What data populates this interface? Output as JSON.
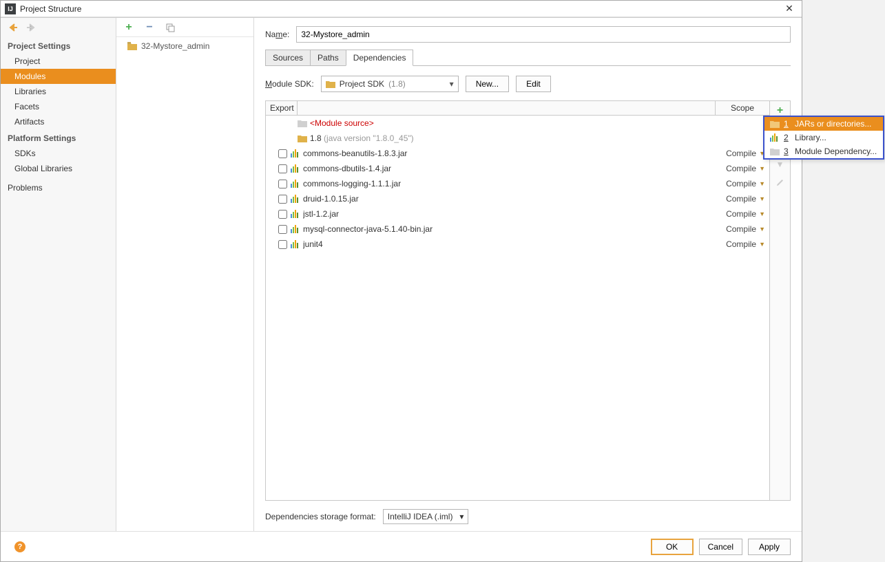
{
  "window": {
    "title": "Project Structure"
  },
  "leftNav": {
    "section1": "Project Settings",
    "items1": [
      "Project",
      "Modules",
      "Libraries",
      "Facets",
      "Artifacts"
    ],
    "selectedIndex1": 1,
    "section2": "Platform Settings",
    "items2": [
      "SDKs",
      "Global Libraries"
    ],
    "problems": "Problems"
  },
  "midTree": {
    "root": "32-Mystore_admin"
  },
  "nameRow": {
    "label_pre": "Na",
    "label_ul": "m",
    "label_post": "e:",
    "value": "32-Mystore_admin"
  },
  "tabs": [
    "Sources",
    "Paths",
    "Dependencies"
  ],
  "activeTab": 2,
  "moduleSdk": {
    "label_ul": "M",
    "label_post": "odule SDK:",
    "value_main": "Project SDK",
    "value_suffix": "(1.8)",
    "newBtn": "New...",
    "editBtn": "Edit"
  },
  "depsHeader": {
    "export": "Export",
    "scope": "Scope"
  },
  "depsFixed": {
    "moduleSource": "<Module source>",
    "jdk_main": "1.8",
    "jdk_suffix": "(java version \"1.8.0_45\")"
  },
  "deps": [
    {
      "name": "commons-beanutils-1.8.3.jar",
      "scope": "Compile"
    },
    {
      "name": "commons-dbutils-1.4.jar",
      "scope": "Compile"
    },
    {
      "name": "commons-logging-1.1.1.jar",
      "scope": "Compile"
    },
    {
      "name": "druid-1.0.15.jar",
      "scope": "Compile"
    },
    {
      "name": "jstl-1.2.jar",
      "scope": "Compile"
    },
    {
      "name": "mysql-connector-java-5.1.40-bin.jar",
      "scope": "Compile"
    },
    {
      "name": "junit4",
      "scope": "Compile"
    }
  ],
  "storage": {
    "label": "Dependencies storage format:",
    "value": "IntelliJ IDEA (.iml)"
  },
  "footer": {
    "ok": "OK",
    "cancel": "Cancel",
    "apply": "Apply"
  },
  "popup": {
    "items": [
      {
        "num": "1",
        "label": "JARs or directories..."
      },
      {
        "num": "2",
        "label": "Library..."
      },
      {
        "num": "3",
        "label": "Module Dependency..."
      }
    ],
    "selectedIndex": 0
  }
}
